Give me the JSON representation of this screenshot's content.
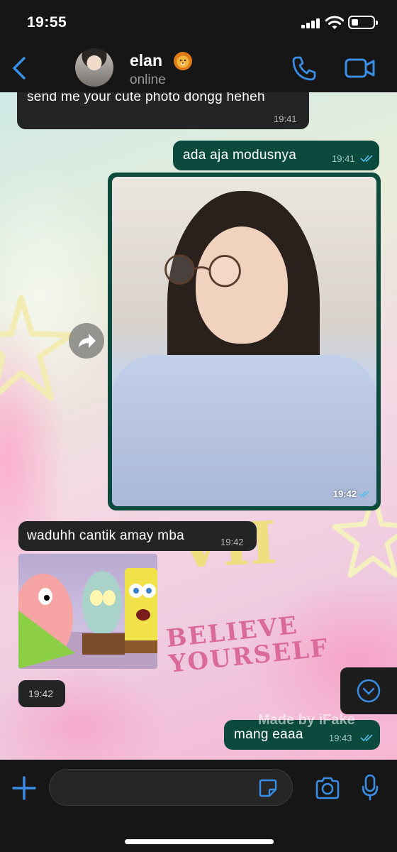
{
  "status_bar": {
    "time": "19:55"
  },
  "header": {
    "name": "elan",
    "status": "online",
    "name_emoji_icon": "lion-face-icon"
  },
  "messages": [
    {
      "direction": "incoming",
      "text": "send me your cute photo dongg heheh",
      "time": "19:41"
    },
    {
      "direction": "outgoing",
      "text": "ada aja modusnya",
      "time": "19:41",
      "read": true
    },
    {
      "direction": "outgoing",
      "type": "photo",
      "time": "19:42",
      "read": true
    },
    {
      "direction": "incoming",
      "text": "waduhh cantik amay mba",
      "time": "19:42"
    },
    {
      "direction": "incoming",
      "type": "sticker",
      "time": "19:42"
    },
    {
      "direction": "outgoing",
      "text": "mang eaaa",
      "time": "19:43",
      "read": true
    }
  ],
  "wallpaper": {
    "text": "BELIEVE YOURSELF",
    "numeral": "VII"
  },
  "watermark": "Made by iFake",
  "colors": {
    "accent": "#3a8ee6",
    "outgoing_bubble": "#0b4a3c",
    "incoming_bubble": "#232426",
    "read_ticks": "#53bdeb"
  },
  "input": {
    "placeholder": ""
  }
}
